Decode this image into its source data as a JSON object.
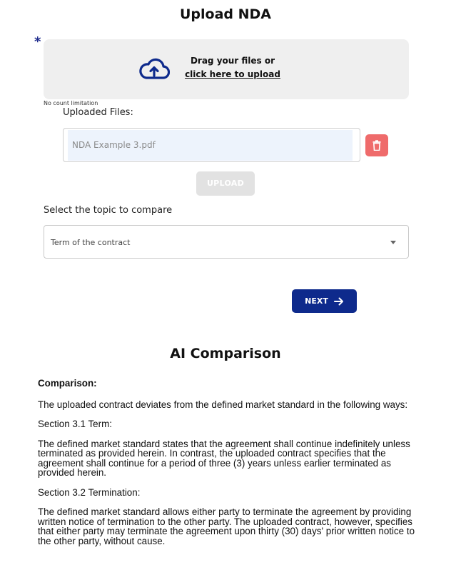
{
  "upload": {
    "title": "Upload NDA",
    "required_marker": "*",
    "dropzone_line1": "Drag your files or",
    "dropzone_link": "click here to upload",
    "count_note": "No count limitation",
    "uploaded_label": "Uploaded Files:",
    "file_name": "NDA Example 3.pdf",
    "upload_button": "UPLOAD"
  },
  "topic": {
    "label": "Select the topic to compare",
    "selected": "Term of the contract"
  },
  "next_button": "NEXT",
  "ai": {
    "title": "AI Comparison",
    "heading": "Comparison:",
    "paragraphs": [
      "The uploaded contract deviates from the defined market standard in the following ways:",
      "Section 3.1 Term:",
      "The defined market standard states that the agreement shall continue indefinitely unless terminated as provided herein. In contrast, the uploaded contract specifies that the agreement shall continue for a period of three (3) years unless earlier terminated as provided herein.",
      "Section 3.2 Termination:",
      "The defined market standard allows either party to terminate the agreement by providing written notice of termination to the other party. The uploaded contract, however, specifies that either party may terminate the agreement upon thirty (30) days' prior written notice to the other party, without cause."
    ]
  },
  "icons": {
    "cloud": "cloud-upload-icon",
    "trash": "trash-icon",
    "arrow": "arrow-right-icon",
    "caret": "caret-down-icon"
  },
  "colors": {
    "primary": "#0e2a8c",
    "delete": "#ef6b6b",
    "disabled": "#e2e2e2",
    "dropzone_bg": "#efefef",
    "file_bg": "#edf3fc"
  }
}
